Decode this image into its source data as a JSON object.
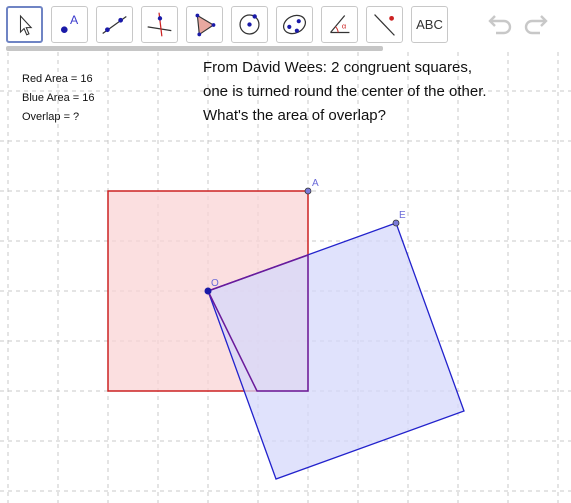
{
  "toolbar": {
    "tools": [
      {
        "icon": "move-arrow-icon"
      },
      {
        "icon": "point-icon",
        "label": "A"
      },
      {
        "icon": "line-icon"
      },
      {
        "icon": "perpendicular-line-icon"
      },
      {
        "icon": "polygon-icon"
      },
      {
        "icon": "circle-center-icon"
      },
      {
        "icon": "ellipse-icon"
      },
      {
        "icon": "angle-icon",
        "label": "α"
      },
      {
        "icon": "reflect-icon"
      },
      {
        "icon": "text-icon",
        "label": "ABC"
      }
    ],
    "undo_icon": "undo-icon",
    "redo_icon": "redo-icon"
  },
  "info": {
    "red_area": "Red Area = 16",
    "blue_area": "Blue Area = 16",
    "overlap": "Overlap = ?"
  },
  "description": {
    "line1": "From David Wees: 2 congruent squares,",
    "line2": "one is turned round the center of the other.",
    "line3": "What's the area of overlap?"
  },
  "points": {
    "A": "A",
    "E": "E",
    "O": "O"
  },
  "colors": {
    "red_stroke": "#cc2222",
    "red_fill": "#f9d4d6",
    "blue_stroke": "#2222cc",
    "blue_fill": "#d6d8fb",
    "overlap_stroke": "#6a1a9a",
    "point_fill": "#1a1aa8",
    "point_label": "#6a6ad8",
    "grid": "#c8c8c8",
    "active_tool_border": "#6f84c4"
  }
}
